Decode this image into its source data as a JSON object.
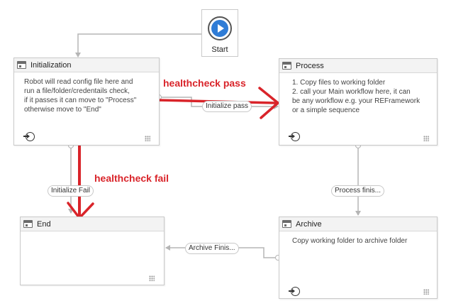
{
  "start": {
    "label": "Start"
  },
  "states": {
    "initialization": {
      "title": "Initialization",
      "body": "Robot will read config file here and\nrun a file/folder/credentails check,\nif it passes it can move to \"Process\"\notherwise move to \"End\""
    },
    "process": {
      "title": "Process",
      "body": "1. Copy files to working folder\n2. call your Main workflow here, it can\nbe any workflow e.g. your REFramework\nor a simple sequence"
    },
    "end": {
      "title": "End",
      "body": ""
    },
    "archive": {
      "title": "Archive",
      "body": "Copy working folder to archive folder"
    }
  },
  "transitions": {
    "initialize_pass": "Initialize pass",
    "initialize_fail": "Initialize Fail",
    "process_finished": "Process finis...",
    "archive_finished": "Archive Finis..."
  },
  "annotations": {
    "pass": "healthcheck pass",
    "fail": "healthcheck fail",
    "color": "#d9242a"
  },
  "colors": {
    "connector": "#b5b5b5",
    "annotation_red": "#d9242a",
    "start_blue": "#2f7cd6"
  }
}
